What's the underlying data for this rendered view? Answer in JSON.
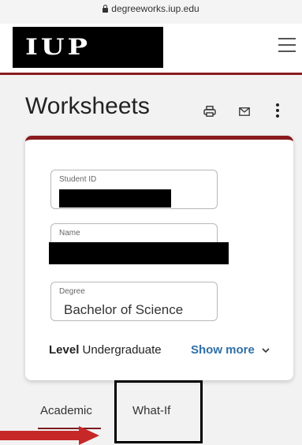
{
  "browser": {
    "url": "degreeworks.iup.edu"
  },
  "header": {
    "logo_text": "IUP"
  },
  "page": {
    "title": "Worksheets"
  },
  "student_card": {
    "student_id_label": "Student ID",
    "name_label": "Name",
    "degree_label": "Degree",
    "degree_value": "Bachelor of Science",
    "level_label": "Level",
    "level_value": "Undergraduate",
    "show_more_label": "Show more"
  },
  "tabs": [
    {
      "label": "Academic",
      "selected": true
    },
    {
      "label": "What-If",
      "selected": false
    }
  ],
  "colors": {
    "brand_red": "#8a1b1e",
    "link_blue": "#2f6fa8",
    "annotation_arrow": "#c62828"
  }
}
